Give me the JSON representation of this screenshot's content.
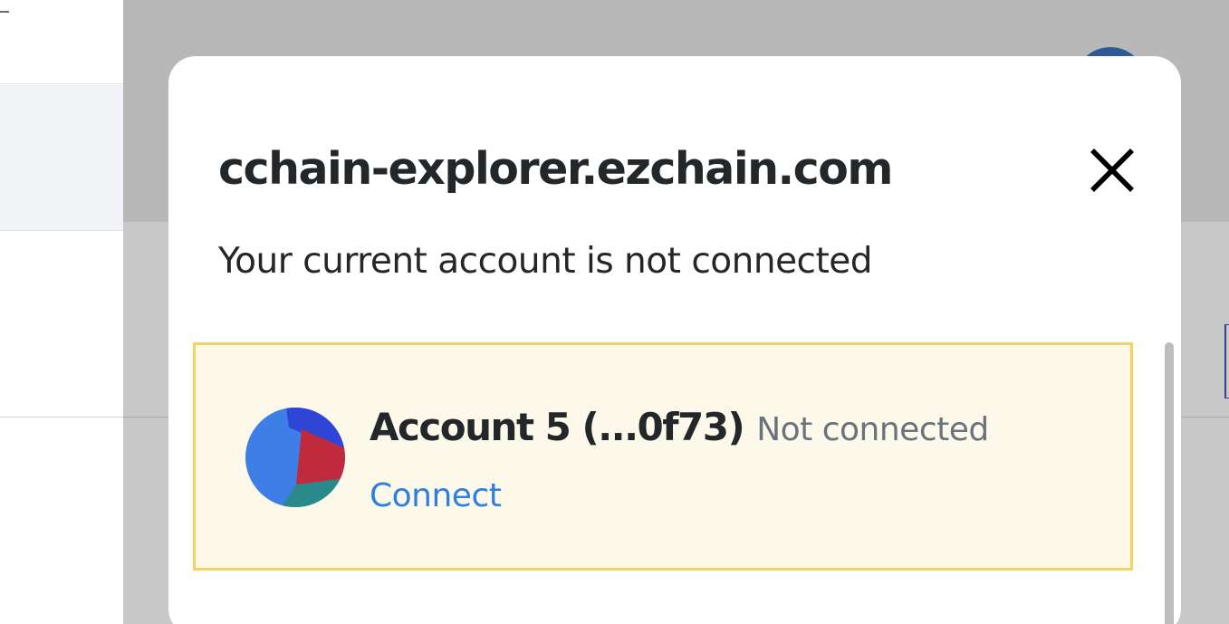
{
  "popup": {
    "site": "cchain-explorer.ezchain.com",
    "message": "Your current account is not connected"
  },
  "account": {
    "name": "Account 5 (...0f73)",
    "status": "Not connected",
    "connect_label": "Connect"
  },
  "icons": {
    "close": "close-icon",
    "account_avatar": "jazzicon-avatar"
  },
  "colors": {
    "card_background": "#fcf9ea",
    "card_border": "#f5d35f",
    "link": "#2f7fe0",
    "text_primary": "#24272a",
    "text_muted": "#6a737d",
    "overlay": "#b8b8b8"
  }
}
